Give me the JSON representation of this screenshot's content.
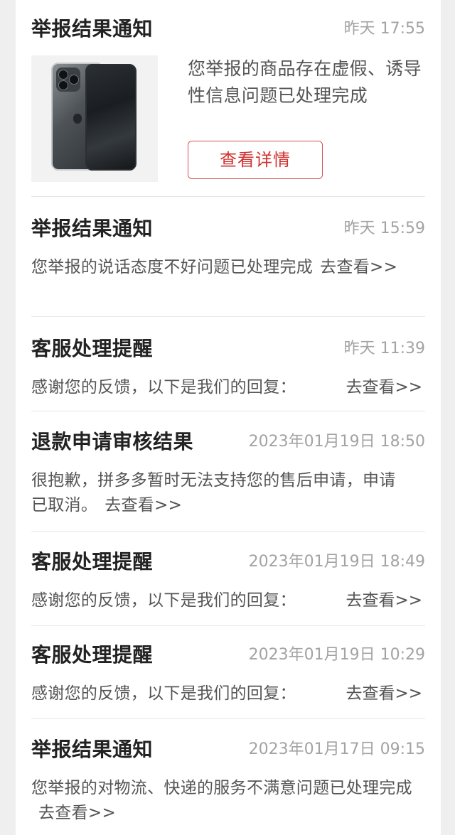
{
  "notifications": [
    {
      "title": "举报结果通知",
      "time": "昨天 17:55",
      "body": "您举报的商品存在虚假、诱导性信息问题已处理完成",
      "button_label": "查看详情",
      "image": "phone-product-image"
    },
    {
      "title": "举报结果通知",
      "time": "昨天 15:59",
      "body": "您举报的说话态度不好问题已处理完成",
      "link": "去查看>>"
    },
    {
      "title": "客服处理提醒",
      "time": "昨天 11:39",
      "body": "感谢您的反馈，以下是我们的回复：",
      "link": "去查看>>"
    },
    {
      "title": "退款申请审核结果",
      "time": "2023年01月19日 18:50",
      "body": "很抱歉，拼多多暂时无法支持您的售后申请，申请已取消。",
      "link": "去查看>>"
    },
    {
      "title": "客服处理提醒",
      "time": "2023年01月19日 18:49",
      "body": "感谢您的反馈，以下是我们的回复：",
      "link": "去查看>>"
    },
    {
      "title": "客服处理提醒",
      "time": "2023年01月19日 10:29",
      "body": "感谢您的反馈，以下是我们的回复：",
      "link": "去查看>>"
    },
    {
      "title": "举报结果通知",
      "time": "2023年01月17日 09:15",
      "body": "您举报的对物流、快递的服务不满意问题已处理完成",
      "link": "去查看>>"
    }
  ],
  "colors": {
    "accent_red": "#d0312d",
    "background": "#efefef",
    "card": "#ffffff",
    "muted_text": "#a3a3a3"
  }
}
